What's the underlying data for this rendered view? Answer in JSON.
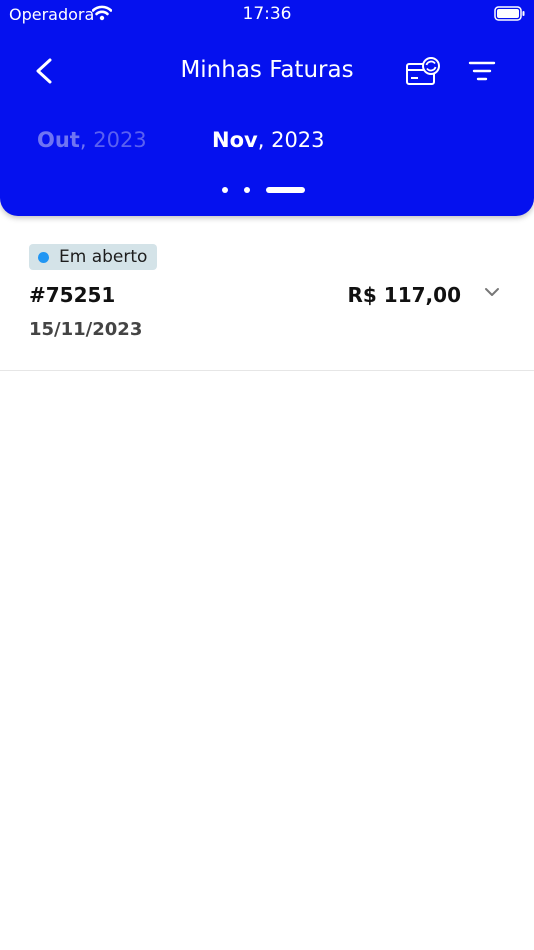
{
  "status_bar": {
    "carrier": "Operadora",
    "time": "17:36"
  },
  "nav": {
    "title": "Minhas Faturas"
  },
  "months": {
    "previous": {
      "month": "Out",
      "separator": ",",
      "year": "2023"
    },
    "current": {
      "month": "Nov",
      "separator": ",",
      "year": "2023"
    }
  },
  "invoice": {
    "status": "Em aberto",
    "number": "#75251",
    "date": "15/11/2023",
    "amount": "R$ 117,00"
  },
  "colors": {
    "header": "#0511ef",
    "badge_background": "#d4e3e8",
    "status_dot": "#2196f3"
  },
  "icons": [
    "back-arrow-icon",
    "card-refresh-icon",
    "filter-icon",
    "chevron-down-icon",
    "wifi-icon",
    "battery-icon"
  ]
}
